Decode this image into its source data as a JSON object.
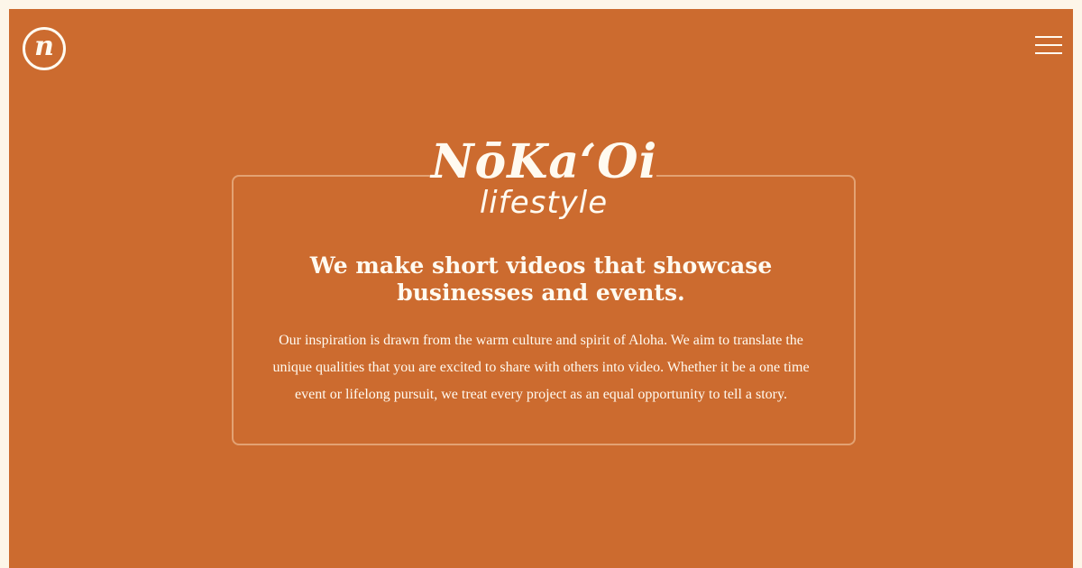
{
  "header": {
    "logo_letter": "n",
    "logo_icon": "n-circle-logo-icon",
    "menu_icon": "hamburger-menu-icon"
  },
  "brand": {
    "name": "NōKa‘Oi",
    "subtitle": "lifestyle"
  },
  "hero": {
    "headline": "We make short videos that showcase businesses and events.",
    "description": "Our inspiration is drawn from the warm culture and spirit of Aloha. We aim to translate the unique qualities that you are excited to share with others into video. Whether it be a one time event or lifelong pursuit, we treat every project as an equal opportunity to tell a story."
  },
  "colors": {
    "background": "#cc6b2f",
    "frame": "#fdf6e9",
    "text": "#fffaf0"
  }
}
